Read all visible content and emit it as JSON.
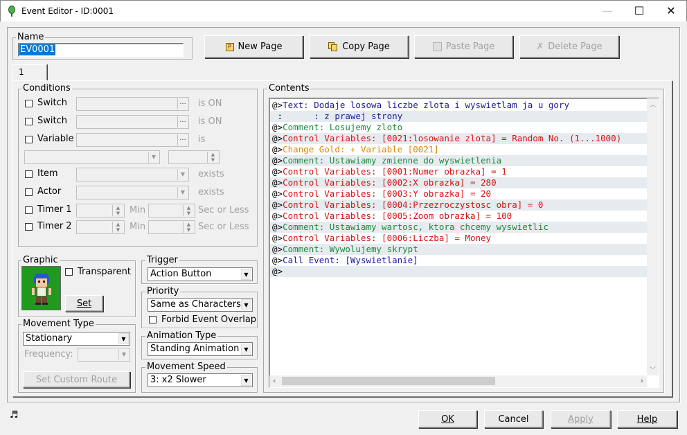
{
  "window": {
    "title": "Event Editor - ID:0001",
    "minimize": "—",
    "maximize": "☐",
    "close": "✕"
  },
  "name_group": {
    "label": "Name",
    "value": "EV0001"
  },
  "page_buttons": {
    "new_page": "New Page",
    "copy_page": "Copy Page",
    "paste_page": "Paste Page",
    "delete_page": "Delete Page"
  },
  "tabs": [
    "1"
  ],
  "conditions": {
    "label": "Conditions",
    "switch1": {
      "label": "Switch",
      "suffix": "is ON"
    },
    "switch2": {
      "label": "Switch",
      "suffix": "is ON"
    },
    "variable": {
      "label": "Variable",
      "suffix": "is"
    },
    "item": {
      "label": "Item",
      "suffix": "exists"
    },
    "actor": {
      "label": "Actor",
      "suffix": "exists"
    },
    "timer1": {
      "label": "Timer 1",
      "min": "Min",
      "sec": "Sec or Less"
    },
    "timer2": {
      "label": "Timer 2",
      "min": "Min",
      "sec": "Sec or Less"
    },
    "ellipsis": "..."
  },
  "graphic": {
    "label": "Graphic",
    "transparent": "Transparent",
    "set": "Set"
  },
  "trigger": {
    "label": "Trigger",
    "value": "Action Button"
  },
  "priority": {
    "label": "Priority",
    "value": "Same as Characters",
    "forbid_overlap": "Forbid Event Overlap"
  },
  "movement_type": {
    "label": "Movement Type",
    "value": "Stationary",
    "frequency": "Frequency:",
    "custom_route": "Set Custom Route"
  },
  "animation_type": {
    "label": "Animation Type",
    "value": "Standing Animation"
  },
  "movement_speed": {
    "label": "Movement Speed",
    "value": "3: x2 Slower"
  },
  "contents": {
    "label": "Contents",
    "lines": [
      {
        "prefix": "@>",
        "text": "Text: Dodaje losowa liczbe zlota i wyswietlam ja u gory",
        "color": "c-blue"
      },
      {
        "prefix": " :",
        "text": "      : z prawej strony",
        "color": "c-blue"
      },
      {
        "prefix": "@>",
        "text": "Comment: Losujemy zloto",
        "color": "c-green"
      },
      {
        "prefix": "@>",
        "text": "Control Variables: [0021:losowanie zlota] = Random No. (1...1000)",
        "color": "c-red"
      },
      {
        "prefix": "@>",
        "text": "Change Gold: + Variable [0021]",
        "color": "c-orange"
      },
      {
        "prefix": "@>",
        "text": "Comment: Ustawiamy zmienne do wyswietlenia",
        "color": "c-green"
      },
      {
        "prefix": "@>",
        "text": "Control Variables: [0001:Numer obrazka] = 1",
        "color": "c-red"
      },
      {
        "prefix": "@>",
        "text": "Control Variables: [0002:X obrazka] = 280",
        "color": "c-red"
      },
      {
        "prefix": "@>",
        "text": "Control Variables: [0003:Y obrazka] = 20",
        "color": "c-red"
      },
      {
        "prefix": "@>",
        "text": "Control Variables: [0004:Przezroczystosc obra] = 0",
        "color": "c-red"
      },
      {
        "prefix": "@>",
        "text": "Control Variables: [0005:Zoom obrazka] = 100",
        "color": "c-red"
      },
      {
        "prefix": "@>",
        "text": "Comment: Ustawiamy wartosc, ktora chcemy wyswietlic",
        "color": "c-green"
      },
      {
        "prefix": "@>",
        "text": "Control Variables: [0006:Liczba] = Money",
        "color": "c-red"
      },
      {
        "prefix": "@>",
        "text": "Comment: Wywolujemy skrypt",
        "color": "c-green"
      },
      {
        "prefix": "@>",
        "text": "Call Event: [Wyswietlanie]",
        "color": "c-blue"
      },
      {
        "prefix": "@>",
        "text": "",
        "color": "c-black"
      }
    ]
  },
  "footer": {
    "ok": "OK",
    "cancel": "Cancel",
    "apply": "Apply",
    "help": "Help"
  }
}
